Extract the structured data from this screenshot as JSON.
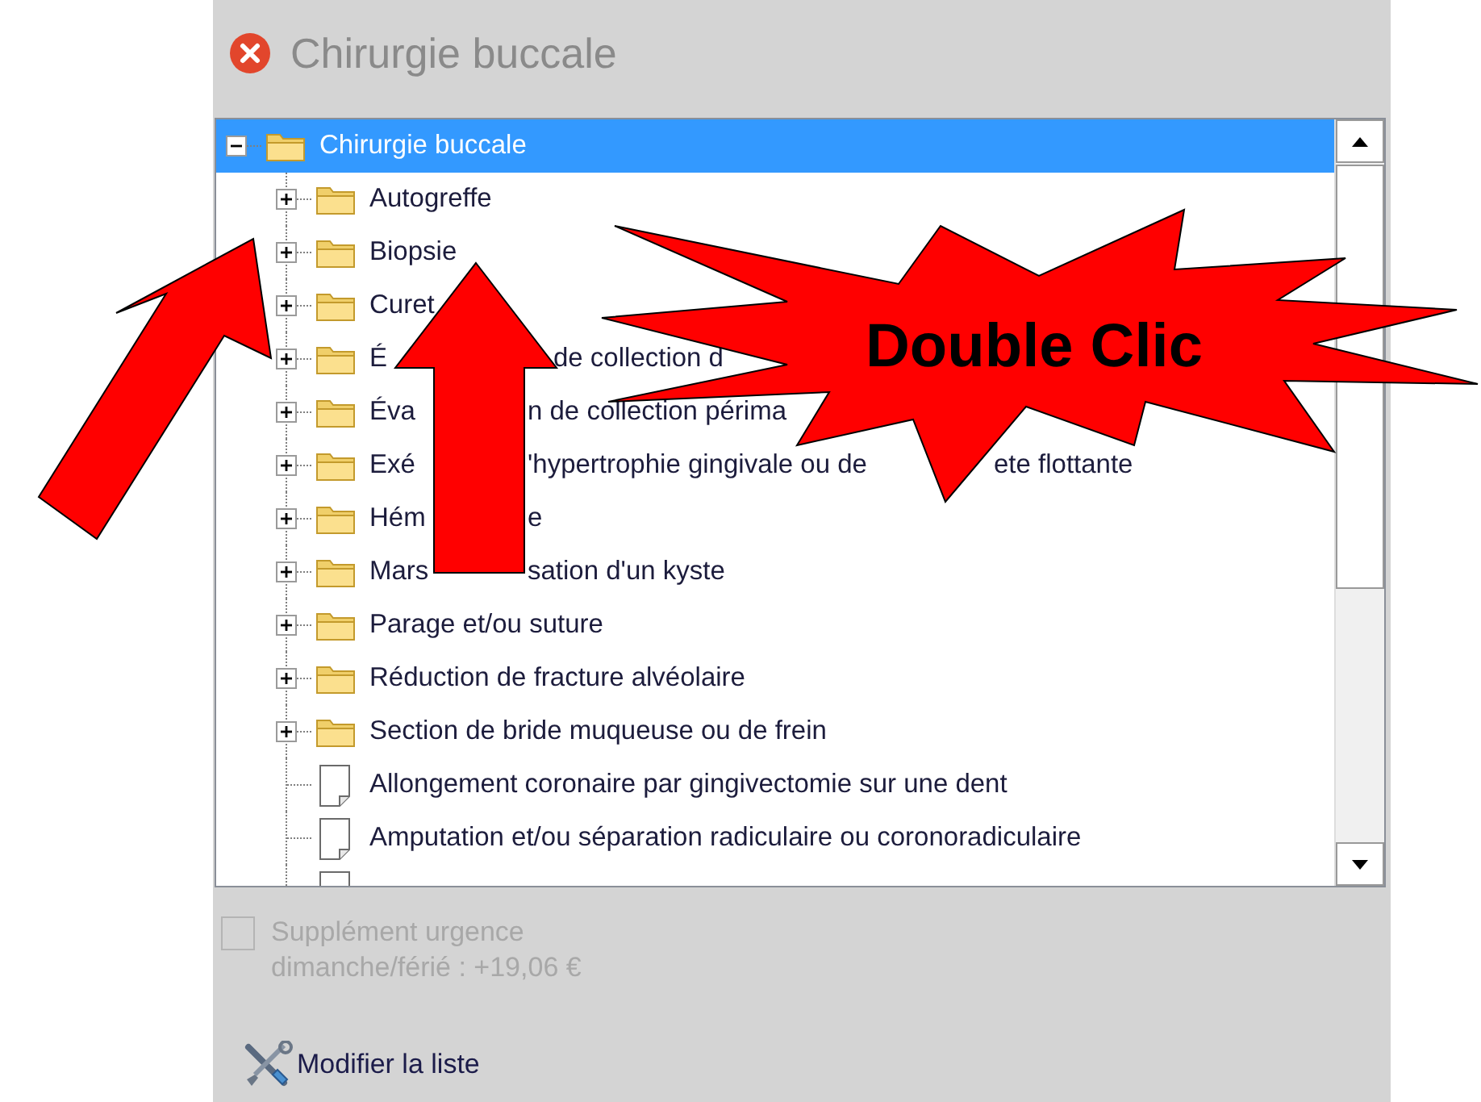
{
  "window": {
    "title": "Chirurgie buccale"
  },
  "tree": {
    "kind": "folder",
    "label": "Chirurgie buccale",
    "expanded": true,
    "selected": true,
    "children": [
      {
        "kind": "folder",
        "label": "Autogreffe",
        "expanded": false,
        "selected": false
      },
      {
        "kind": "folder",
        "label": "Biopsie",
        "expanded": false,
        "selected": false
      },
      {
        "kind": "folder",
        "visible_parts": [
          "Curet"
        ],
        "expanded": false,
        "selected": false
      },
      {
        "kind": "folder",
        "visible_parts": [
          "É",
          "de collection d"
        ],
        "expanded": false,
        "selected": false
      },
      {
        "kind": "folder",
        "visible_parts": [
          "Éva",
          "n de collection périma"
        ],
        "expanded": false,
        "selected": false
      },
      {
        "kind": "folder",
        "visible_parts": [
          "Exé",
          "'hypertrophie gingivale ou de",
          "ete flottante"
        ],
        "expanded": false,
        "selected": false
      },
      {
        "kind": "folder",
        "visible_parts": [
          "Hém",
          "e"
        ],
        "expanded": false,
        "selected": false
      },
      {
        "kind": "folder",
        "visible_parts": [
          "Mars",
          "sation d'un kyste"
        ],
        "expanded": false,
        "selected": false
      },
      {
        "kind": "folder",
        "label": "Parage et/ou suture",
        "expanded": false,
        "selected": false
      },
      {
        "kind": "folder",
        "label": "Réduction de fracture alvéolaire",
        "expanded": false,
        "selected": false
      },
      {
        "kind": "folder",
        "label": "Section de bride muqueuse ou de frein",
        "expanded": false,
        "selected": false
      },
      {
        "kind": "document",
        "label": "Allongement coronaire par gingivectomie sur une dent",
        "selected": false
      },
      {
        "kind": "document",
        "label": "Amputation et/ou séparation radiculaire ou coronoradiculaire",
        "selected": false
      },
      {
        "kind": "document"
      }
    ]
  },
  "emergency_supplement": {
    "label": "Supplément urgence dimanche/férié : +19,06 €",
    "checked": false,
    "disabled": true
  },
  "edit_list_link": {
    "label": "Modifier la liste"
  },
  "annotation": {
    "text": "Double Clic"
  }
}
